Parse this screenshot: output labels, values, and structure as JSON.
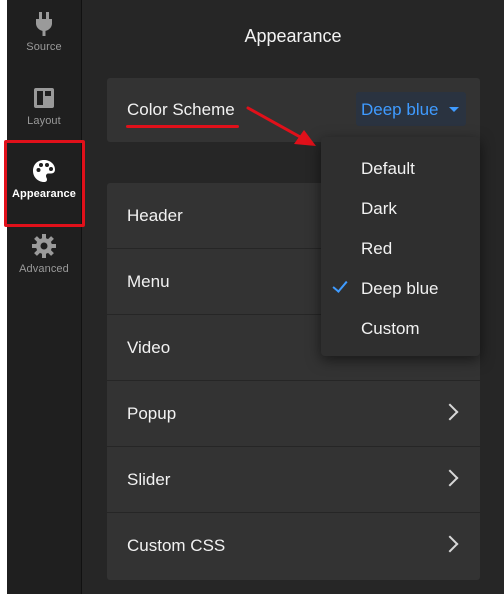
{
  "sidebar": {
    "items": [
      {
        "label": "Source",
        "icon": "plug-icon"
      },
      {
        "label": "Layout",
        "icon": "layout-icon"
      },
      {
        "label": "Appearance",
        "icon": "palette-icon",
        "active": true
      },
      {
        "label": "Advanced",
        "icon": "gear-icon"
      }
    ]
  },
  "main": {
    "title": "Appearance",
    "color_scheme": {
      "label": "Color Scheme",
      "selected": "Deep blue"
    },
    "rows": [
      {
        "label": "Header"
      },
      {
        "label": "Menu"
      },
      {
        "label": "Video"
      },
      {
        "label": "Popup"
      },
      {
        "label": "Slider"
      },
      {
        "label": "Custom CSS"
      }
    ]
  },
  "dropdown": {
    "options": [
      {
        "label": "Default"
      },
      {
        "label": "Dark"
      },
      {
        "label": "Red"
      },
      {
        "label": "Deep blue",
        "selected": true
      },
      {
        "label": "Custom"
      }
    ]
  },
  "colors": {
    "accent": "#3f9bff",
    "annotation_red": "#e0101a",
    "background": "#262626",
    "card": "#333333",
    "sidebar": "#1f1f1f"
  }
}
